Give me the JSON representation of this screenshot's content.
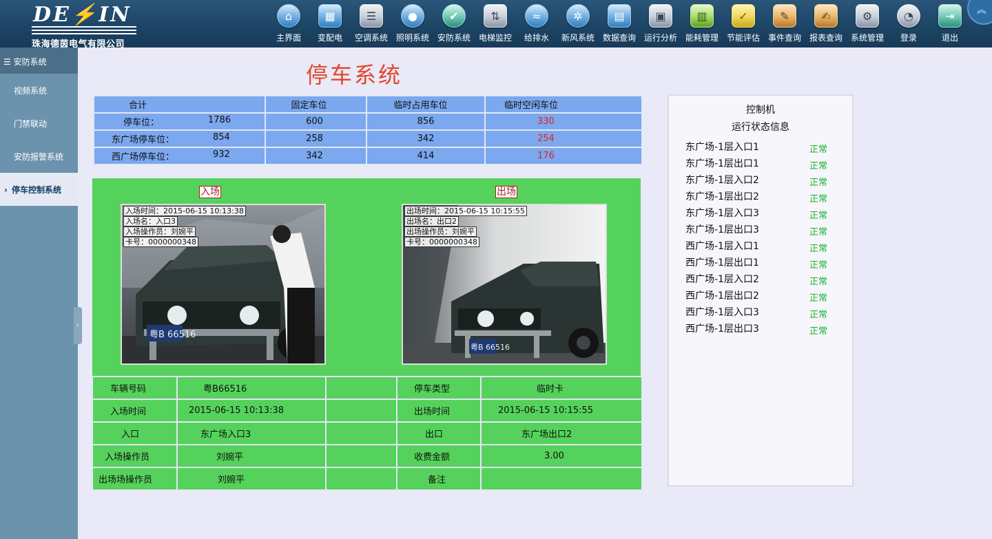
{
  "app": {
    "logo_text": "DE IN",
    "company": "珠海德茵电气有限公司"
  },
  "nav": [
    {
      "label": "主界面",
      "icon": "home-icon"
    },
    {
      "label": "变配电",
      "icon": "power-distribution-icon"
    },
    {
      "label": "空调系统",
      "icon": "air-conditioner-icon"
    },
    {
      "label": "照明系统",
      "icon": "lightbulb-icon"
    },
    {
      "label": "安防系统",
      "icon": "shield-icon"
    },
    {
      "label": "电梯监控",
      "icon": "elevator-icon"
    },
    {
      "label": "给排水",
      "icon": "water-icon"
    },
    {
      "label": "新风系统",
      "icon": "fresh-air-icon"
    },
    {
      "label": "数据查询",
      "icon": "data-query-icon"
    },
    {
      "label": "运行分析",
      "icon": "analysis-icon"
    },
    {
      "label": "能耗管理",
      "icon": "energy-icon"
    },
    {
      "label": "节能评估",
      "icon": "evaluation-icon"
    },
    {
      "label": "事件查询",
      "icon": "event-icon"
    },
    {
      "label": "报表查询",
      "icon": "report-icon"
    },
    {
      "label": "系统管理",
      "icon": "gear-icon"
    },
    {
      "label": "登录",
      "icon": "login-icon"
    },
    {
      "label": "退出",
      "icon": "exit-icon"
    }
  ],
  "sidebar": {
    "header": "安防系统",
    "items": [
      {
        "label": "视频系统"
      },
      {
        "label": "门禁联动"
      },
      {
        "label": "安防报警系统"
      },
      {
        "label": "停车控制系统",
        "active": true
      }
    ]
  },
  "page": {
    "title": "停车系统"
  },
  "summary": {
    "headers": [
      "合计",
      "固定车位",
      "临时占用车位",
      "临时空闲车位"
    ],
    "rows": [
      {
        "label": "停车位：",
        "total": "1786",
        "fixed": "600",
        "temp_used": "856",
        "temp_free": "330"
      },
      {
        "label": "东广场停车位：",
        "total": "854",
        "fixed": "258",
        "temp_used": "342",
        "temp_free": "254"
      },
      {
        "label": "西广场停车位：",
        "total": "932",
        "fixed": "342",
        "temp_used": "414",
        "temp_free": "176"
      }
    ]
  },
  "entry_camera": {
    "label": "入场",
    "info": [
      "入场时间：2015-06-15 10:13:38",
      "入场名：入口3",
      "入场操作员：刘婉平",
      "卡号：0000000348"
    ]
  },
  "exit_camera": {
    "label": "出场",
    "info": [
      "出场时间：2015-06-15 10:15:55",
      "出场名：出口2",
      "出场操作员：刘婉平",
      "卡号：0000000348"
    ]
  },
  "plate_text": "粤B 66516",
  "details": {
    "plate_label": "车辆号码",
    "plate_value": "粤B66516",
    "type_label": "停车类型",
    "type_value": "临时卡",
    "in_time_label": "入场时间",
    "in_time_value": "2015-06-15 10:13:38",
    "out_time_label": "出场时间",
    "out_time_value": "2015-06-15 10:15:55",
    "entrance_label": "入口",
    "entrance_value": "东广场入口3",
    "exit_label": "出口",
    "exit_value": "东广场出口2",
    "in_operator_label": "入场操作员",
    "in_operator_value": "刘婉平",
    "fee_label": "收费金额",
    "fee_value": "3.00",
    "out_operator_label": "出场场操作员",
    "out_operator_value": "刘婉平",
    "remark_label": "备注",
    "remark_value": ""
  },
  "controller": {
    "title": "控制机",
    "subtitle": "运行状态信息",
    "items": [
      {
        "name": "东广场-1层入口1",
        "status": "正常"
      },
      {
        "name": "东广场-1层出口1",
        "status": "正常"
      },
      {
        "name": "东广场-1层入口2",
        "status": "正常"
      },
      {
        "name": "东广场-1层出口2",
        "status": "正常"
      },
      {
        "name": "东广场-1层入口3",
        "status": "正常"
      },
      {
        "name": "东广场-1层出口3",
        "status": "正常"
      },
      {
        "name": "西广场-1层入口1",
        "status": "正常"
      },
      {
        "name": "西广场-1层出口1",
        "status": "正常"
      },
      {
        "name": "西广场-1层入口2",
        "status": "正常"
      },
      {
        "name": "西广场-1层出口2",
        "status": "正常"
      },
      {
        "name": "西广场-1层入口3",
        "status": "正常"
      },
      {
        "name": "西广场-1层出口3",
        "status": "正常"
      }
    ]
  },
  "colors": {
    "topbar": "#1d4566",
    "sidebar": "#6b93ad",
    "title": "#e2462b",
    "summary_bg": "#7ba8ee",
    "panel_bg": "#55d25b",
    "status_ok": "#19b32a",
    "free_red": "#e42020"
  }
}
